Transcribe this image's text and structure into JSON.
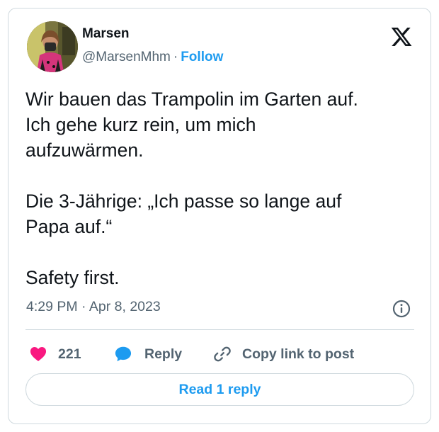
{
  "author": {
    "display_name": "Marsen",
    "handle": "@MarsenMhm",
    "separator": "·",
    "follow_label": "Follow"
  },
  "tweet": {
    "text": "Wir bauen das Trampolin im Garten auf.\nIch gehe kurz rein, um mich\naufzuwärmen.\n\nDie 3-Jährige: „Ich passe so lange auf\nPapa auf.“\n\nSafety first.",
    "timestamp": "4:29 PM · Apr 8, 2023"
  },
  "actions": {
    "like_count": "221",
    "reply_label": "Reply",
    "copy_link_label": "Copy link to post"
  },
  "read_replies_label": "Read 1 reply",
  "icons": {
    "logo": "x-logo-icon",
    "info": "info-icon",
    "like": "heart-icon",
    "reply": "speech-bubble-icon",
    "copy": "link-icon"
  },
  "colors": {
    "accent": "#1d9bf0",
    "like": "#f91880",
    "muted_text": "#536471",
    "border": "#cfd9de"
  }
}
